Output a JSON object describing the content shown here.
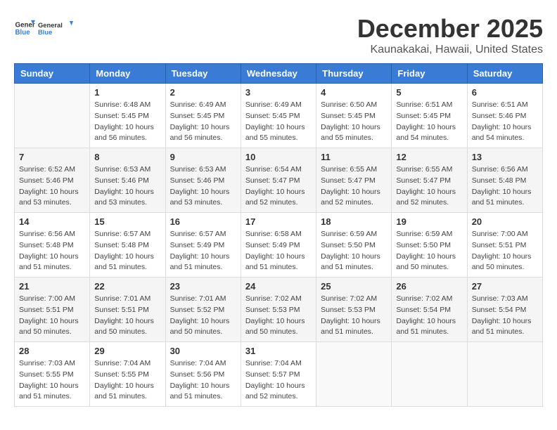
{
  "header": {
    "logo_general": "General",
    "logo_blue": "Blue",
    "month": "December 2025",
    "location": "Kaunakakai, Hawaii, United States"
  },
  "days_of_week": [
    "Sunday",
    "Monday",
    "Tuesday",
    "Wednesday",
    "Thursday",
    "Friday",
    "Saturday"
  ],
  "weeks": [
    [
      {
        "day": "",
        "sunrise": "",
        "sunset": "",
        "daylight": ""
      },
      {
        "day": "1",
        "sunrise": "Sunrise: 6:48 AM",
        "sunset": "Sunset: 5:45 PM",
        "daylight": "Daylight: 10 hours and 56 minutes."
      },
      {
        "day": "2",
        "sunrise": "Sunrise: 6:49 AM",
        "sunset": "Sunset: 5:45 PM",
        "daylight": "Daylight: 10 hours and 56 minutes."
      },
      {
        "day": "3",
        "sunrise": "Sunrise: 6:49 AM",
        "sunset": "Sunset: 5:45 PM",
        "daylight": "Daylight: 10 hours and 55 minutes."
      },
      {
        "day": "4",
        "sunrise": "Sunrise: 6:50 AM",
        "sunset": "Sunset: 5:45 PM",
        "daylight": "Daylight: 10 hours and 55 minutes."
      },
      {
        "day": "5",
        "sunrise": "Sunrise: 6:51 AM",
        "sunset": "Sunset: 5:45 PM",
        "daylight": "Daylight: 10 hours and 54 minutes."
      },
      {
        "day": "6",
        "sunrise": "Sunrise: 6:51 AM",
        "sunset": "Sunset: 5:46 PM",
        "daylight": "Daylight: 10 hours and 54 minutes."
      }
    ],
    [
      {
        "day": "7",
        "sunrise": "Sunrise: 6:52 AM",
        "sunset": "Sunset: 5:46 PM",
        "daylight": "Daylight: 10 hours and 53 minutes."
      },
      {
        "day": "8",
        "sunrise": "Sunrise: 6:53 AM",
        "sunset": "Sunset: 5:46 PM",
        "daylight": "Daylight: 10 hours and 53 minutes."
      },
      {
        "day": "9",
        "sunrise": "Sunrise: 6:53 AM",
        "sunset": "Sunset: 5:46 PM",
        "daylight": "Daylight: 10 hours and 53 minutes."
      },
      {
        "day": "10",
        "sunrise": "Sunrise: 6:54 AM",
        "sunset": "Sunset: 5:47 PM",
        "daylight": "Daylight: 10 hours and 52 minutes."
      },
      {
        "day": "11",
        "sunrise": "Sunrise: 6:55 AM",
        "sunset": "Sunset: 5:47 PM",
        "daylight": "Daylight: 10 hours and 52 minutes."
      },
      {
        "day": "12",
        "sunrise": "Sunrise: 6:55 AM",
        "sunset": "Sunset: 5:47 PM",
        "daylight": "Daylight: 10 hours and 52 minutes."
      },
      {
        "day": "13",
        "sunrise": "Sunrise: 6:56 AM",
        "sunset": "Sunset: 5:48 PM",
        "daylight": "Daylight: 10 hours and 51 minutes."
      }
    ],
    [
      {
        "day": "14",
        "sunrise": "Sunrise: 6:56 AM",
        "sunset": "Sunset: 5:48 PM",
        "daylight": "Daylight: 10 hours and 51 minutes."
      },
      {
        "day": "15",
        "sunrise": "Sunrise: 6:57 AM",
        "sunset": "Sunset: 5:48 PM",
        "daylight": "Daylight: 10 hours and 51 minutes."
      },
      {
        "day": "16",
        "sunrise": "Sunrise: 6:57 AM",
        "sunset": "Sunset: 5:49 PM",
        "daylight": "Daylight: 10 hours and 51 minutes."
      },
      {
        "day": "17",
        "sunrise": "Sunrise: 6:58 AM",
        "sunset": "Sunset: 5:49 PM",
        "daylight": "Daylight: 10 hours and 51 minutes."
      },
      {
        "day": "18",
        "sunrise": "Sunrise: 6:59 AM",
        "sunset": "Sunset: 5:50 PM",
        "daylight": "Daylight: 10 hours and 51 minutes."
      },
      {
        "day": "19",
        "sunrise": "Sunrise: 6:59 AM",
        "sunset": "Sunset: 5:50 PM",
        "daylight": "Daylight: 10 hours and 50 minutes."
      },
      {
        "day": "20",
        "sunrise": "Sunrise: 7:00 AM",
        "sunset": "Sunset: 5:51 PM",
        "daylight": "Daylight: 10 hours and 50 minutes."
      }
    ],
    [
      {
        "day": "21",
        "sunrise": "Sunrise: 7:00 AM",
        "sunset": "Sunset: 5:51 PM",
        "daylight": "Daylight: 10 hours and 50 minutes."
      },
      {
        "day": "22",
        "sunrise": "Sunrise: 7:01 AM",
        "sunset": "Sunset: 5:51 PM",
        "daylight": "Daylight: 10 hours and 50 minutes."
      },
      {
        "day": "23",
        "sunrise": "Sunrise: 7:01 AM",
        "sunset": "Sunset: 5:52 PM",
        "daylight": "Daylight: 10 hours and 50 minutes."
      },
      {
        "day": "24",
        "sunrise": "Sunrise: 7:02 AM",
        "sunset": "Sunset: 5:53 PM",
        "daylight": "Daylight: 10 hours and 50 minutes."
      },
      {
        "day": "25",
        "sunrise": "Sunrise: 7:02 AM",
        "sunset": "Sunset: 5:53 PM",
        "daylight": "Daylight: 10 hours and 51 minutes."
      },
      {
        "day": "26",
        "sunrise": "Sunrise: 7:02 AM",
        "sunset": "Sunset: 5:54 PM",
        "daylight": "Daylight: 10 hours and 51 minutes."
      },
      {
        "day": "27",
        "sunrise": "Sunrise: 7:03 AM",
        "sunset": "Sunset: 5:54 PM",
        "daylight": "Daylight: 10 hours and 51 minutes."
      }
    ],
    [
      {
        "day": "28",
        "sunrise": "Sunrise: 7:03 AM",
        "sunset": "Sunset: 5:55 PM",
        "daylight": "Daylight: 10 hours and 51 minutes."
      },
      {
        "day": "29",
        "sunrise": "Sunrise: 7:04 AM",
        "sunset": "Sunset: 5:55 PM",
        "daylight": "Daylight: 10 hours and 51 minutes."
      },
      {
        "day": "30",
        "sunrise": "Sunrise: 7:04 AM",
        "sunset": "Sunset: 5:56 PM",
        "daylight": "Daylight: 10 hours and 51 minutes."
      },
      {
        "day": "31",
        "sunrise": "Sunrise: 7:04 AM",
        "sunset": "Sunset: 5:57 PM",
        "daylight": "Daylight: 10 hours and 52 minutes."
      },
      {
        "day": "",
        "sunrise": "",
        "sunset": "",
        "daylight": ""
      },
      {
        "day": "",
        "sunrise": "",
        "sunset": "",
        "daylight": ""
      },
      {
        "day": "",
        "sunrise": "",
        "sunset": "",
        "daylight": ""
      }
    ]
  ]
}
